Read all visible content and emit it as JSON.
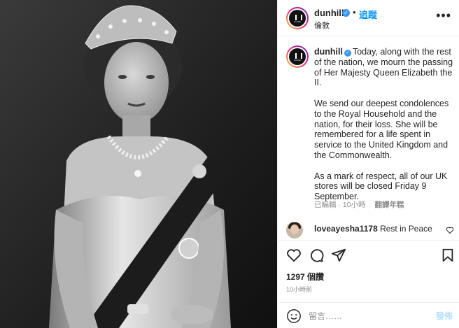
{
  "header": {
    "username": "dunhill",
    "follow_separator": "•",
    "follow_label": "追蹤",
    "location": "倫敦",
    "more_label": "•••"
  },
  "post": {
    "username": "dunhill",
    "caption_p1": "Today, along with the rest of the nation, we mourn the passing of Her Majesty Queen Elizabeth the II.",
    "caption_p2": "We send our deepest condolences to the Royal Household and the nation, for their loss. She will be remembered for a life spent in service to the United Kingdom and the Commonwealth.",
    "caption_p3": "As a mark of respect, all of our UK stores will be closed Friday 9 September.",
    "edited_label": "已編輯",
    "meta_separator": "·",
    "relative_time": "10小時",
    "see_translation_label": "翻譯年糕"
  },
  "comment": {
    "username": "loveayesha1178",
    "text": "Rest in Peace"
  },
  "engagement": {
    "likes_label": "1297 個讚",
    "time_label": "10小時前"
  },
  "add_comment": {
    "placeholder": "留言……",
    "post_label": "發佈"
  },
  "brand": {
    "avatar_logo_text": "dunhill"
  },
  "colors": {
    "accent_blue": "#0095f6",
    "verified_blue": "#3897f0",
    "post_button_disabled": "#b2dffc",
    "muted_text": "#8e8e8e",
    "border": "#efefef"
  },
  "icons": {
    "verified": "verified-badge-icon",
    "more": "more-options-icon",
    "like": "heart-icon",
    "comment": "comment-bubble-icon",
    "share": "paper-plane-icon",
    "save": "bookmark-icon",
    "emoji": "emoji-smiley-icon"
  }
}
